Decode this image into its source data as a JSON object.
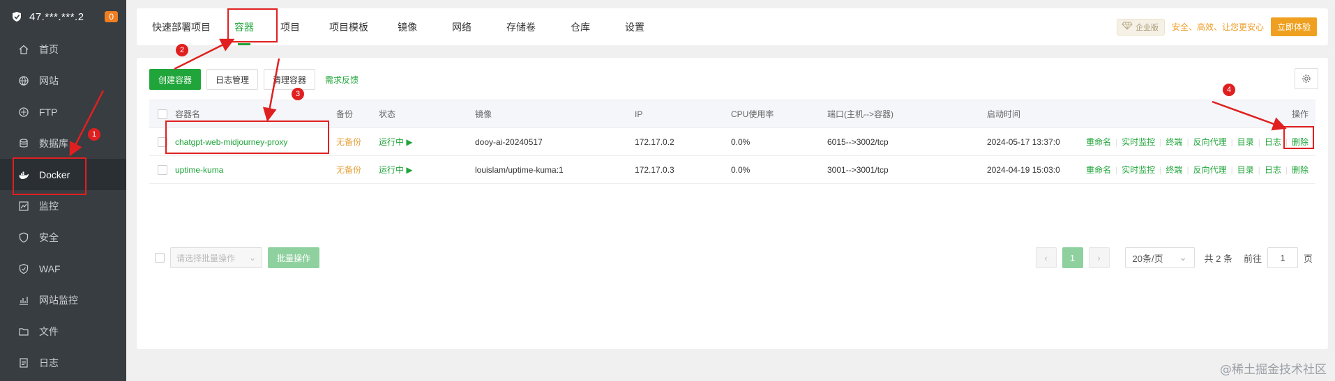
{
  "sidebar": {
    "server_ip": "47.***.***.2",
    "server_count": "0",
    "items": [
      {
        "label": "首页",
        "icon": "home-icon"
      },
      {
        "label": "网站",
        "icon": "globe-icon"
      },
      {
        "label": "FTP",
        "icon": "ftp-icon"
      },
      {
        "label": "数据库",
        "icon": "database-icon"
      },
      {
        "label": "Docker",
        "icon": "docker-icon",
        "active": true
      },
      {
        "label": "监控",
        "icon": "monitor-icon"
      },
      {
        "label": "安全",
        "icon": "shield-icon"
      },
      {
        "label": "WAF",
        "icon": "waf-icon"
      },
      {
        "label": "网站监控",
        "icon": "chart-icon"
      },
      {
        "label": "文件",
        "icon": "folder-icon"
      },
      {
        "label": "日志",
        "icon": "log-icon"
      }
    ]
  },
  "tabs": [
    {
      "label": "快速部署项目"
    },
    {
      "label": "容器",
      "active": true
    },
    {
      "label": "项目"
    },
    {
      "label": "项目模板"
    },
    {
      "label": "镜像"
    },
    {
      "label": "网络"
    },
    {
      "label": "存储卷"
    },
    {
      "label": "仓库"
    },
    {
      "label": "设置"
    }
  ],
  "promo": {
    "badge": "企业版",
    "text": "安全、高效、让您更安心",
    "button": "立即体验"
  },
  "toolbar": {
    "create": "创建容器",
    "logs": "日志管理",
    "clean": "清理容器",
    "feedback": "需求反馈"
  },
  "table": {
    "headers": [
      "容器名",
      "备份",
      "状态",
      "镜像",
      "IP",
      "CPU使用率",
      "端口(主机-->容器)",
      "启动时间",
      "操作"
    ],
    "rows": [
      {
        "name": "chatgpt-web-midjourney-proxy",
        "backup": "无备份",
        "status": "运行中 ▶",
        "image": "dooy-ai-20240517",
        "ip": "172.17.0.2",
        "cpu": "0.0%",
        "port": "6015-->3002/tcp",
        "started": "2024-05-17 13:37:0"
      },
      {
        "name": "uptime-kuma",
        "backup": "无备份",
        "status": "运行中 ▶",
        "image": "louislam/uptime-kuma:1",
        "ip": "172.17.0.3",
        "cpu": "0.0%",
        "port": "3001-->3001/tcp",
        "started": "2024-04-19 15:03:0"
      }
    ],
    "ops": [
      "重命名",
      "实时监控",
      "终端",
      "反向代理",
      "目录",
      "日志",
      "删除"
    ]
  },
  "batch": {
    "select_placeholder": "请选择批量操作",
    "button": "批量操作"
  },
  "pager": {
    "prev": "‹",
    "current": "1",
    "next": "›",
    "page_size": "20条/页",
    "total": "共 2 条",
    "goto_label": "前往",
    "goto_value": "1",
    "page_unit": "页"
  },
  "annotations": [
    "1",
    "2",
    "3",
    "4"
  ],
  "watermark": "@稀土掘金技术社区",
  "colors": {
    "accent": "#20a53a",
    "sidebar": "#373d41",
    "annotation": "#e02020"
  }
}
